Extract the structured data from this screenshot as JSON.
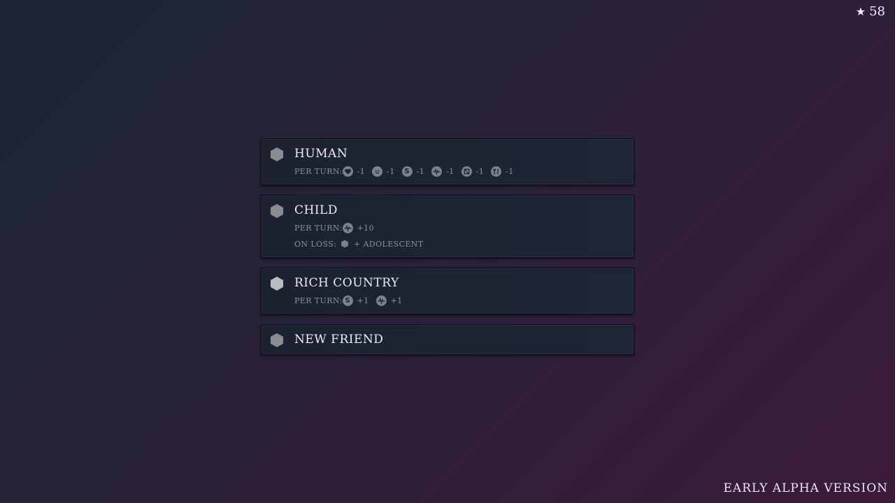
{
  "score": {
    "icon": "star-icon",
    "value": "58"
  },
  "version_label": "EARLY ALPHA VERSION",
  "cards": [
    {
      "title": "HUMAN",
      "icon": "hexagon-icon",
      "per_turn_label": "PER TURN:",
      "per_turn": [
        {
          "icon": "heart-icon",
          "value": "-1"
        },
        {
          "icon": "face-icon",
          "value": "-1"
        },
        {
          "icon": "money-icon",
          "value": "-1"
        },
        {
          "icon": "health-icon",
          "value": "-1"
        },
        {
          "icon": "box-icon",
          "value": "-1"
        },
        {
          "icon": "food-icon",
          "value": "-1"
        }
      ]
    },
    {
      "title": "CHILD",
      "icon": "hexagon-icon",
      "per_turn_label": "PER TURN:",
      "per_turn": [
        {
          "icon": "health-icon",
          "value": "+10"
        }
      ],
      "on_loss_label": "ON LOSS:",
      "on_loss": {
        "icon": "hexagon-icon",
        "value": "+ ADOLESCENT"
      }
    },
    {
      "title": "RICH COUNTRY",
      "icon": "hexagon-icon",
      "per_turn_label": "PER TURN:",
      "per_turn": [
        {
          "icon": "money-icon",
          "value": "+1"
        },
        {
          "icon": "health-icon",
          "value": "+1"
        }
      ]
    },
    {
      "title": "NEW FRIEND",
      "icon": "hexagon-icon"
    }
  ]
}
